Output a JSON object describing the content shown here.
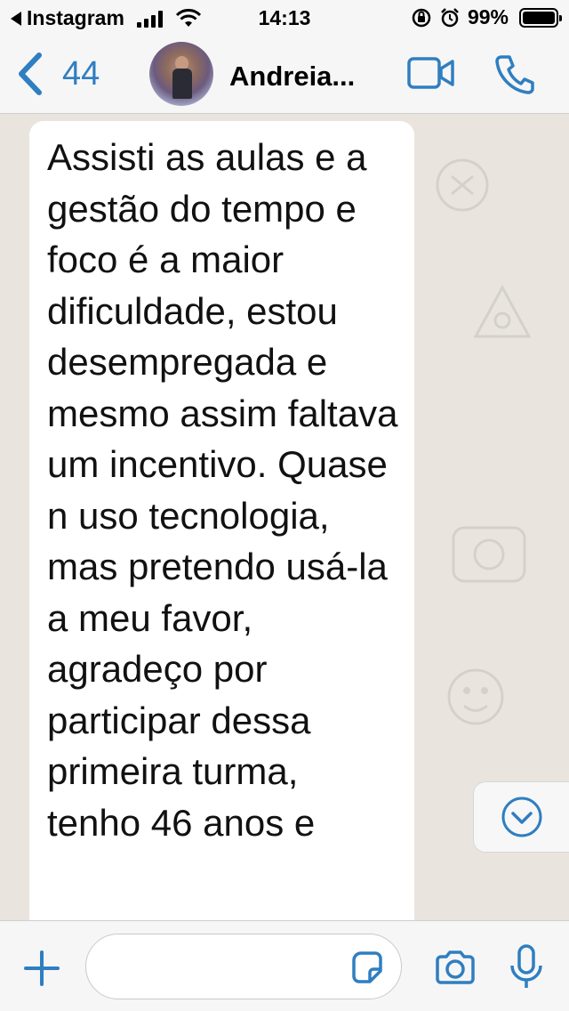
{
  "status_bar": {
    "back_app": "Instagram",
    "time": "14:13",
    "battery": "99%",
    "battery_level": 0.99
  },
  "nav": {
    "back_count": "44",
    "contact_name": "Andreia..."
  },
  "message": {
    "text": "Assisti as aulas e a gestão do tempo e foco é a maior dificuldade, estou desempregada e mesmo assim faltava um incentivo. Quase n uso tecnologia, mas pretendo usá-la a meu favor, agradeço por participar dessa primeira turma, tenho 46 anos e"
  },
  "input": {
    "placeholder": ""
  },
  "colors": {
    "accent": "#2f7ec1",
    "chat_background": "#e9e5de",
    "bubble": "#ffffff"
  },
  "icons": {
    "back": "chevron-left-icon",
    "video": "video-camera-icon",
    "phone": "phone-icon",
    "scroll": "chevron-down-circle-icon",
    "attach": "plus-icon",
    "sticker": "sticker-icon",
    "camera": "camera-icon",
    "mic": "microphone-icon"
  }
}
